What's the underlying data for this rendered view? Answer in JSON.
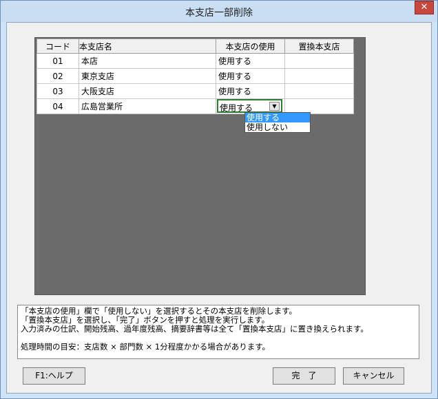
{
  "window": {
    "title": "本支店一部削除",
    "close_label": "✕"
  },
  "grid": {
    "headers": {
      "code": "コード",
      "name": "本支店名",
      "use": "本支店の使用",
      "replace": "置換本支店"
    },
    "rows": [
      {
        "code": "01",
        "name": "本店",
        "use": "使用する",
        "replace": ""
      },
      {
        "code": "02",
        "name": "東京支店",
        "use": "使用する",
        "replace": ""
      },
      {
        "code": "03",
        "name": "大阪支店",
        "use": "使用する",
        "replace": ""
      },
      {
        "code": "04",
        "name": "広島営業所",
        "use": "使用する",
        "replace": ""
      }
    ],
    "dropdown_options": [
      "使用する",
      "使用しない"
    ]
  },
  "info": {
    "line1": "「本支店の使用」欄で「使用しない」を選択するとその本支店を削除します。",
    "line2": "「置換本支店」を選択し、「完了」ボタンを押すと処理を実行します。",
    "line3": "入力済みの仕訳、開始残高、過年度残高、摘要辞書等は全て「置換本支店」に置き換えられます。",
    "line4": "処理時間の目安：支店数 × 部門数 × 1分程度かかる場合があります。"
  },
  "buttons": {
    "help": "F1:ヘルプ",
    "done": "完　了",
    "cancel": "キャンセル"
  }
}
